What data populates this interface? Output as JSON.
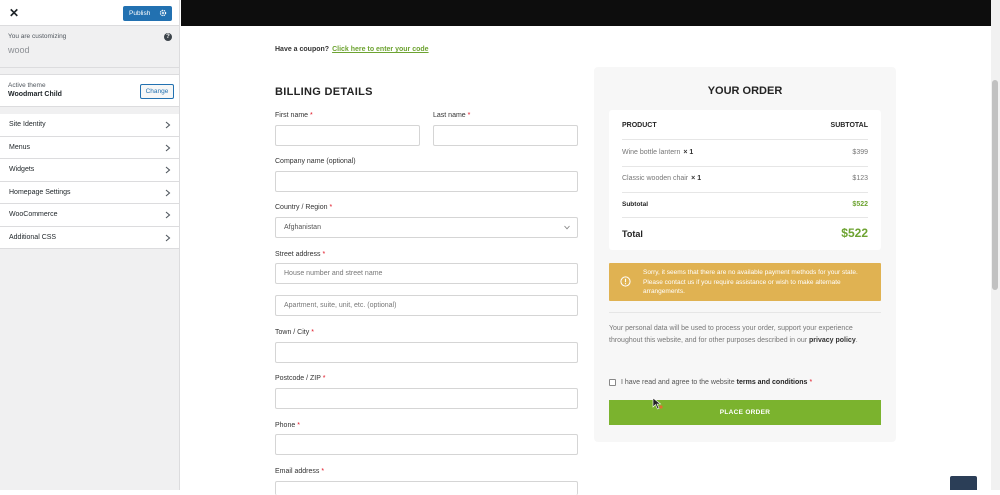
{
  "customizer": {
    "close_glyph": "✕",
    "publish_label": "Publish",
    "you_are_customizing": "You are customizing",
    "site_name": "wood",
    "help_glyph": "?",
    "active_theme_label": "Active theme",
    "theme_name": "Woodmart Child",
    "change_label": "Change",
    "menu": [
      {
        "label": "Site Identity"
      },
      {
        "label": "Menus"
      },
      {
        "label": "Widgets"
      },
      {
        "label": "Homepage Settings"
      },
      {
        "label": "WooCommerce"
      },
      {
        "label": "Additional CSS"
      }
    ]
  },
  "checkout": {
    "coupon_prompt": "Have a coupon?",
    "coupon_link": "Click here to enter your code",
    "billing_title": "BILLING DETAILS",
    "fields": {
      "first_name": "First name",
      "last_name": "Last name",
      "company": "Company name (optional)",
      "country": "Country / Region",
      "country_value": "Afghanistan",
      "street": "Street address",
      "street_placeholder_1": "House number and street name",
      "street_placeholder_2": "Apartment, suite, unit, etc. (optional)",
      "city": "Town / City",
      "postcode": "Postcode / ZIP",
      "phone": "Phone",
      "email": "Email address"
    },
    "required_mark": "*"
  },
  "order": {
    "title": "YOUR ORDER",
    "col_product": "PRODUCT",
    "col_subtotal": "SUBTOTAL",
    "items": [
      {
        "name": "Wine bottle lantern",
        "qty": "× 1",
        "price": "$399"
      },
      {
        "name": "Classic wooden chair",
        "qty": "× 1",
        "price": "$123"
      }
    ],
    "subtotal_label": "Subtotal",
    "subtotal_value": "$522",
    "total_label": "Total",
    "total_value": "$522",
    "notice": "Sorry, it seems that there are no available payment methods for your state. Please contact us if you require assistance or wish to make alternate arrangements.",
    "privacy_text": "Your personal data will be used to process your order, support your experience throughout this website, and for other purposes described in our",
    "privacy_link": "privacy policy",
    "privacy_end": ".",
    "terms_text": "I have read and agree to the website",
    "terms_link": "terms and conditions",
    "place_order": "PLACE ORDER"
  },
  "colors": {
    "publish_blue": "#2271b1",
    "accent_green": "#7bb32e",
    "notice_amber": "#e0b252"
  }
}
